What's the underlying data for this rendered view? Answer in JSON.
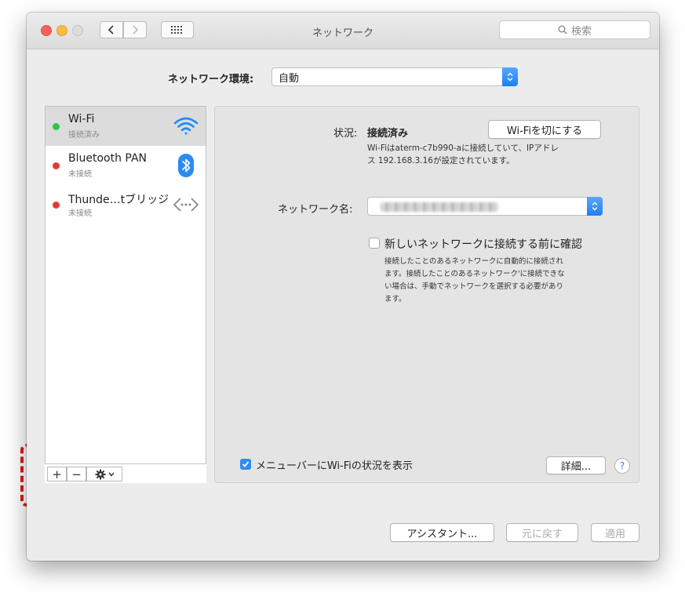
{
  "window": {
    "title": "ネットワーク",
    "search_placeholder": "検索"
  },
  "location": {
    "label": "ネットワーク環境:",
    "value": "自動"
  },
  "services": [
    {
      "name": "Wi-Fi",
      "status": "接続済み",
      "status_color": "#2ec54a",
      "icon": "wifi-icon",
      "selected": true
    },
    {
      "name": "Bluetooth PAN",
      "status": "未接続",
      "status_color": "#e53935",
      "icon": "bluetooth-icon",
      "selected": false
    },
    {
      "name": "Thunde…tブリッジ",
      "status": "未接続",
      "status_color": "#e53935",
      "icon": "thunderbolt-bridge-icon",
      "selected": false
    }
  ],
  "sidebar_tools": {
    "add": "+",
    "remove": "−",
    "gear": "gear-icon"
  },
  "detail": {
    "status_label": "状況:",
    "status_value": "接続済み",
    "toggle_button": "Wi-Fiを切にする",
    "status_desc_line1": "Wi-Fiはaterm-c7b990-aに接続していて、IPアドレ",
    "status_desc_line2": "ス 192.168.3.16が設定されています。",
    "network_name_label": "ネットワーク名:",
    "ask_label": "新しいネットワークに接続する前に確認",
    "ask_desc_line1": "接続したことのあるネットワークに自動的に接続され",
    "ask_desc_line2": "ます。接続したことのあるネットワーク'に接続できな",
    "ask_desc_line3": "い場合は、手動でネットワークを選択する必要があり",
    "ask_desc_line4": "ます。",
    "menubar_label": "メニューバーにWi-Fiの状況を表示",
    "advanced_button": "詳細...",
    "help": "?"
  },
  "footer": {
    "assistant": "アシスタント...",
    "revert": "元に戻す",
    "apply": "適用"
  },
  "colors": {
    "accent": "#2f8cf5",
    "highlight": "#e11717"
  }
}
